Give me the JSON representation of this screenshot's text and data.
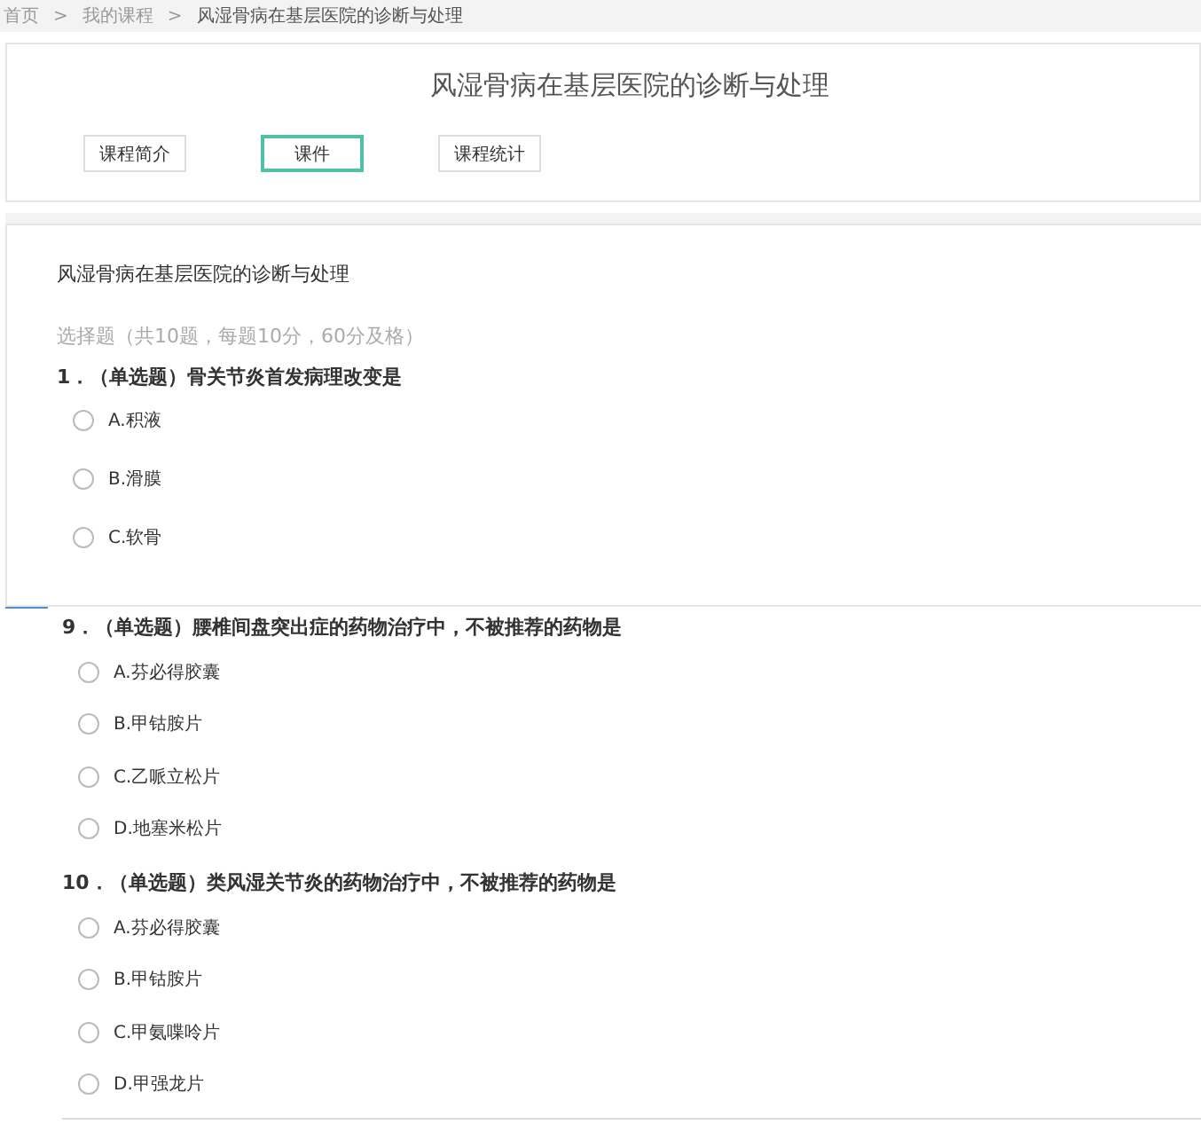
{
  "breadcrumb": [
    {
      "label": "首页",
      "current": false
    },
    {
      "label": "我的课程",
      "current": false
    },
    {
      "label": "风湿骨病在基层医院的诊断与处理",
      "current": true
    }
  ],
  "breadcrumb_separator": ">",
  "course_title": "风湿骨病在基层医院的诊断与处理",
  "tabs": [
    {
      "label": "课程简介",
      "selected": false
    },
    {
      "label": "课件",
      "selected": true
    },
    {
      "label": "课程统计",
      "selected": false
    }
  ],
  "quiz": {
    "title": "风湿骨病在基层医院的诊断与处理",
    "section": "选择题（共10题，每题10分，60分及格）",
    "questions": [
      {
        "number": "1．",
        "type": "（单选题）",
        "text": "骨关节炎首发病理改变是",
        "options": [
          {
            "label": "A.积液",
            "selected": false
          },
          {
            "label": "B.滑膜",
            "selected": false
          },
          {
            "label": "C.软骨",
            "selected": false
          }
        ]
      }
    ]
  },
  "continued_questions": [
    {
      "number": "9．",
      "type": "（单选题）",
      "text": "腰椎间盘突出症的药物治疗中，不被推荐的药物是",
      "options": [
        {
          "label": "A.芬必得胶囊",
          "selected": false
        },
        {
          "label": "B.甲钴胺片",
          "selected": false
        },
        {
          "label": "C.乙哌立松片",
          "selected": false
        },
        {
          "label": "D.地塞米松片",
          "selected": false
        }
      ]
    },
    {
      "number": "10．",
      "type": "（单选题）",
      "text": "类风湿关节炎的药物治疗中，不被推荐的药物是",
      "options": [
        {
          "label": "A.芬必得胶囊",
          "selected": false
        },
        {
          "label": "B.甲钴胺片",
          "selected": false
        },
        {
          "label": "C.甲氨喋呤片",
          "selected": false
        },
        {
          "label": "D.甲强龙片",
          "selected": false
        }
      ]
    }
  ]
}
